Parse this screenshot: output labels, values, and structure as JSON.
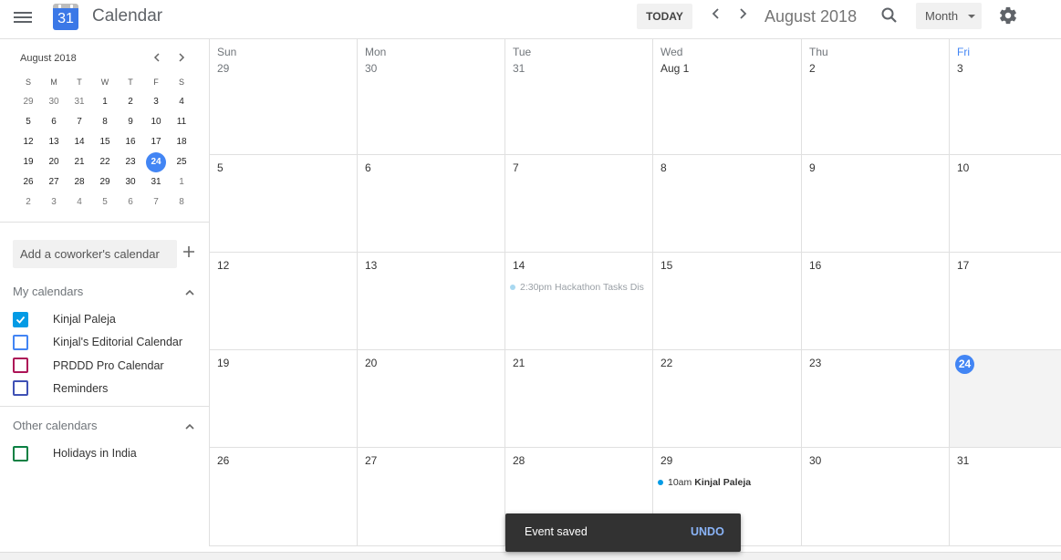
{
  "header": {
    "app_title": "Calendar",
    "logo_day": "31",
    "today_label": "TODAY",
    "prev_label": "‹",
    "next_label": "›",
    "current_period": "August 2018",
    "view_label": "Month"
  },
  "mini_calendar": {
    "title": "August 2018",
    "prev_label": "‹",
    "next_label": "›",
    "weekday_heads": [
      "S",
      "M",
      "T",
      "W",
      "T",
      "F",
      "S"
    ],
    "weeks": [
      [
        "29",
        "30",
        "31",
        "1",
        "2",
        "3",
        "4"
      ],
      [
        "5",
        "6",
        "7",
        "8",
        "9",
        "10",
        "11"
      ],
      [
        "12",
        "13",
        "14",
        "15",
        "16",
        "17",
        "18"
      ],
      [
        "19",
        "20",
        "21",
        "22",
        "23",
        "24",
        "25"
      ],
      [
        "26",
        "27",
        "28",
        "29",
        "30",
        "31",
        "1"
      ],
      [
        "2",
        "3",
        "4",
        "5",
        "6",
        "7",
        "8"
      ]
    ],
    "today": "24"
  },
  "sidebar": {
    "add_calendar_placeholder": "Add a coworker's calendar",
    "add_icon": "+",
    "my_calendars_label": "My calendars",
    "my_calendars": [
      {
        "label": "Kinjal Paleja",
        "checked": true,
        "color": "#039be5"
      },
      {
        "label": "Kinjal's Editorial Calendar",
        "checked": false,
        "color": "#4285f4"
      },
      {
        "label": "PRDDD Pro Calendar",
        "checked": false,
        "color": "#ad1457"
      },
      {
        "label": "Reminders",
        "checked": false,
        "color": "#3f51b5"
      }
    ],
    "other_calendars_label": "Other calendars",
    "other_calendars": [
      {
        "label": "Holidays in India",
        "checked": false,
        "color": "#0b8043"
      }
    ]
  },
  "month_grid": {
    "weekdays": [
      "Sun",
      "Mon",
      "Tue",
      "Wed",
      "Thu",
      "Fri"
    ],
    "weeks": [
      [
        "29",
        "30",
        "31",
        "Aug 1",
        "2",
        "3"
      ],
      [
        "5",
        "6",
        "7",
        "8",
        "9",
        "10"
      ],
      [
        "12",
        "13",
        "14",
        "15",
        "16",
        "17"
      ],
      [
        "19",
        "20",
        "21",
        "22",
        "23",
        "24"
      ],
      [
        "26",
        "27",
        "28",
        "29",
        "30",
        "31"
      ]
    ],
    "today": "24",
    "events": [
      {
        "date": "14",
        "time": "2:30pm",
        "title": "Hackathon Tasks Dis",
        "status": "past"
      },
      {
        "date": "29",
        "time": "10am",
        "title": "Kinjal Paleja",
        "status": "future"
      }
    ]
  },
  "snackbar": {
    "message": "Event saved",
    "action": "UNDO"
  }
}
